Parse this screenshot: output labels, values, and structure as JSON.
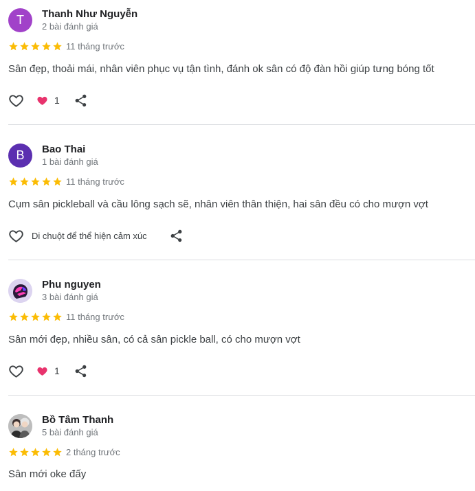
{
  "reviews": [
    {
      "avatar_letter": "T",
      "avatar_color": "#a142c9",
      "name": "Thanh Như Nguyễn",
      "review_count": "2 bài đánh giá",
      "rating": 5,
      "time": "11 tháng trước",
      "text": "Sân đẹp, thoải mái, nhân viên phục vụ tận tình, đánh ok sân có độ đàn hồi giúp tưng bóng tốt",
      "reaction_count": "1"
    },
    {
      "avatar_letter": "B",
      "avatar_color": "#5b2fb0",
      "name": "Bao Thai",
      "review_count": "1 bài đánh giá",
      "rating": 5,
      "time": "11 tháng trước",
      "text": "Cụm sân pickleball và cầu lông sạch sẽ, nhân viên thân thiện, hai sân đều có cho mượn vợt",
      "hover_hint": "Di chuột để thể hiện cảm xúc"
    },
    {
      "name": "Phu nguyen",
      "review_count": "3 bài đánh giá",
      "rating": 5,
      "time": "11 tháng trước",
      "text": "Sân mới đẹp, nhiều sân, có cả sân pickle ball, có cho mượn vợt",
      "reaction_count": "1"
    },
    {
      "name": "Bồ Tâm Thanh",
      "review_count": "5 bài đánh giá",
      "rating": 5,
      "time": "2 tháng trước",
      "text": "Sân mới oke đấy"
    }
  ],
  "colors": {
    "star": "#fbbc04",
    "heart_fill": "#e8336d",
    "divider": "#dadce0"
  },
  "icons": [
    "heart-outline-icon",
    "heart-reaction-icon",
    "share-icon",
    "star-icon"
  ]
}
